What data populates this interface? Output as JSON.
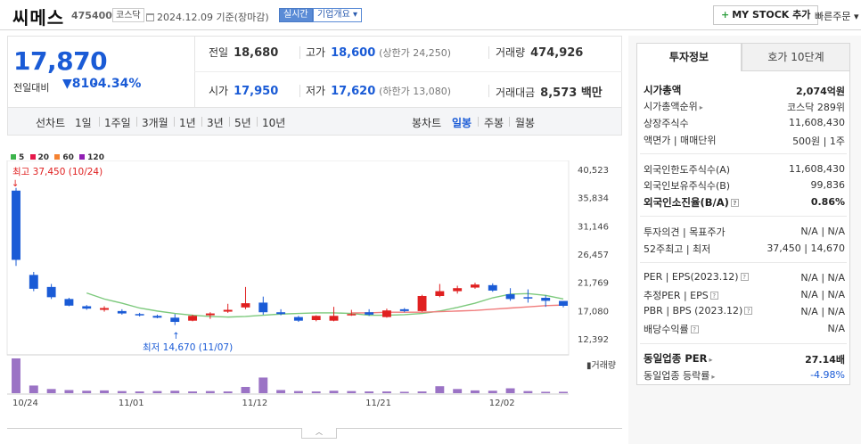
{
  "header": {
    "name": "씨메스",
    "code": "475400",
    "market": "코스닥",
    "date": "2024.12.09 기준(장마감)",
    "live_label": "실시간",
    "company_info_label": "기업개요 ▾",
    "mystock_label": "MY STOCK 추가",
    "order_label": "빠른주문 ▾"
  },
  "price": {
    "current": "17,870",
    "change_label": "전일대비",
    "change_value": "▼810",
    "change_rate": "-4.34%"
  },
  "stats": {
    "prev_label": "전일",
    "prev_value": "18,680",
    "high_label": "고가",
    "high_value": "18,600",
    "high_limit": "(상한가 24,250)",
    "volume_label": "거래량",
    "volume_value": "474,926",
    "open_label": "시가",
    "open_value": "17,950",
    "low_label": "저가",
    "low_value": "17,620",
    "low_limit": "(하한가 13,080)",
    "amount_label": "거래대금",
    "amount_value": "8,573 백만"
  },
  "periods": {
    "line_chart": "선차트",
    "items": [
      "1일",
      "1주일",
      "3개월",
      "1년",
      "3년",
      "5년",
      "10년"
    ],
    "candle_chart": "봉차트",
    "candle_items": [
      "일봉",
      "주봉",
      "월봉"
    ],
    "active_candle": "일봉"
  },
  "chart_data": {
    "type": "candlestick",
    "ma_legend": [
      {
        "name": "5",
        "color": "#3cb44b"
      },
      {
        "name": "20",
        "color": "#e6194b"
      },
      {
        "name": "60",
        "color": "#f58231"
      },
      {
        "name": "120",
        "color": "#911eb4"
      }
    ],
    "high_annotation": "최고 37,450 (10/24)",
    "low_annotation": "최저 14,670 (11/07)",
    "y_ticks": [
      "40,523",
      "35,834",
      "31,146",
      "26,457",
      "21,769",
      "17,080",
      "12,392"
    ],
    "ylim": [
      12392,
      40523
    ],
    "x_ticks": [
      "10/24",
      "11/01",
      "11/12",
      "11/21",
      "12/02"
    ],
    "volume_label": "거래량",
    "candles": [
      {
        "o": 37000,
        "h": 37450,
        "l": 24500,
        "c": 25500
      },
      {
        "o": 23000,
        "h": 23500,
        "l": 20300,
        "c": 20700
      },
      {
        "o": 21000,
        "h": 21500,
        "l": 19000,
        "c": 19300
      },
      {
        "o": 19000,
        "h": 19200,
        "l": 17800,
        "c": 17900
      },
      {
        "o": 17800,
        "h": 18000,
        "l": 17200,
        "c": 17400
      },
      {
        "o": 17200,
        "h": 17800,
        "l": 16900,
        "c": 17500
      },
      {
        "o": 17000,
        "h": 17300,
        "l": 16400,
        "c": 16600
      },
      {
        "o": 16500,
        "h": 16700,
        "l": 16100,
        "c": 16300
      },
      {
        "o": 16200,
        "h": 16400,
        "l": 15800,
        "c": 15900
      },
      {
        "o": 15900,
        "h": 16500,
        "l": 14670,
        "c": 15200
      },
      {
        "o": 15400,
        "h": 16400,
        "l": 15300,
        "c": 16200
      },
      {
        "o": 16300,
        "h": 16800,
        "l": 15700,
        "c": 16600
      },
      {
        "o": 16900,
        "h": 18200,
        "l": 16700,
        "c": 17200
      },
      {
        "o": 17600,
        "h": 21000,
        "l": 17300,
        "c": 18300
      },
      {
        "o": 18400,
        "h": 19400,
        "l": 16400,
        "c": 16800
      },
      {
        "o": 16800,
        "h": 17300,
        "l": 16300,
        "c": 16500
      },
      {
        "o": 16000,
        "h": 16200,
        "l": 15200,
        "c": 15400
      },
      {
        "o": 15500,
        "h": 16300,
        "l": 15300,
        "c": 16200
      },
      {
        "o": 15400,
        "h": 17700,
        "l": 15300,
        "c": 16200
      },
      {
        "o": 16400,
        "h": 17200,
        "l": 16200,
        "c": 16500
      },
      {
        "o": 16800,
        "h": 17300,
        "l": 16200,
        "c": 16400
      },
      {
        "o": 16000,
        "h": 17400,
        "l": 15900,
        "c": 17100
      },
      {
        "o": 17300,
        "h": 17500,
        "l": 16800,
        "c": 17000
      },
      {
        "o": 17000,
        "h": 19700,
        "l": 16900,
        "c": 19500
      },
      {
        "o": 19500,
        "h": 21500,
        "l": 19300,
        "c": 20300
      },
      {
        "o": 20300,
        "h": 21200,
        "l": 19900,
        "c": 20800
      },
      {
        "o": 20900,
        "h": 21700,
        "l": 20700,
        "c": 21400
      },
      {
        "o": 21300,
        "h": 21600,
        "l": 20200,
        "c": 20400
      },
      {
        "o": 19800,
        "h": 20800,
        "l": 18700,
        "c": 19000
      },
      {
        "o": 19300,
        "h": 20600,
        "l": 18400,
        "c": 19100
      },
      {
        "o": 19200,
        "h": 19600,
        "l": 17700,
        "c": 18700
      },
      {
        "o": 18680,
        "h": 18600,
        "l": 17620,
        "c": 17870
      }
    ],
    "ma5": [
      null,
      null,
      null,
      null,
      20000,
      19000,
      18300,
      17500,
      17000,
      16600,
      16300,
      16100,
      16000,
      16100,
      16300,
      16500,
      16600,
      16700,
      16700,
      16600,
      16300,
      16300,
      16400,
      16600,
      17000,
      17600,
      18300,
      19200,
      19800,
      19900,
      19600,
      19000
    ],
    "ma20": [
      null,
      null,
      null,
      null,
      null,
      null,
      null,
      null,
      null,
      null,
      null,
      null,
      null,
      null,
      null,
      null,
      null,
      null,
      null,
      16700,
      16700,
      16800,
      16800,
      16800,
      16900,
      17000,
      17100,
      17300,
      17500,
      17700,
      17900,
      18000
    ],
    "volumes": [
      100,
      22,
      12,
      9,
      7,
      8,
      6,
      5,
      6,
      7,
      5,
      6,
      5,
      18,
      45,
      9,
      6,
      5,
      7,
      6,
      5,
      5,
      4,
      5,
      20,
      12,
      8,
      7,
      14,
      6,
      4,
      4
    ]
  },
  "right_panel": {
    "tab_active": "투자정보",
    "tab_other": "호가 10단계",
    "market_cap_label": "시가총액",
    "market_cap_value": "2,074억원",
    "rank_label": "시가총액순위",
    "rank_value": "코스닥 289위",
    "shares_label": "상장주식수",
    "shares_value": "11,608,430",
    "face_label": "액면가 | 매매단위",
    "face_value": "500원 | 1주",
    "foreign_limit_label": "외국인한도주식수(A)",
    "foreign_limit_value": "11,608,430",
    "foreign_hold_label": "외국인보유주식수(B)",
    "foreign_hold_value": "99,836",
    "foreign_ratio_label": "외국인소진율(B/A)",
    "foreign_ratio_value": "0.86%",
    "opinion_label": "투자의견 | 목표주가",
    "opinion_value": "N/A | N/A",
    "week52_label": "52주최고 | 최저",
    "week52_value": "37,450 | 14,670",
    "per_label": "PER | EPS(2023.12)",
    "per_value": "N/A | N/A",
    "est_per_label": "추정PER | EPS",
    "est_per_value": "N/A | N/A",
    "pbr_label": "PBR | BPS (2023.12)",
    "pbr_value": "N/A | N/A",
    "dividend_label": "배당수익률",
    "dividend_value": "N/A",
    "sector_per_label": "동일업종 PER",
    "sector_per_value": "27.14배",
    "sector_change_label": "동일업종 등락률",
    "sector_change_value": "-4.98%"
  }
}
